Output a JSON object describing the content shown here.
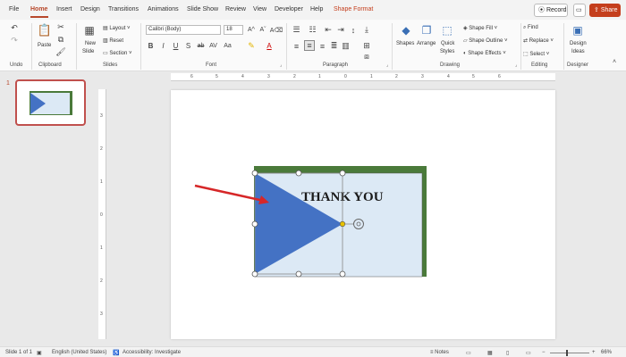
{
  "tabs": [
    {
      "label": "File"
    },
    {
      "label": "Home"
    },
    {
      "label": "Insert"
    },
    {
      "label": "Design"
    },
    {
      "label": "Transitions"
    },
    {
      "label": "Animations"
    },
    {
      "label": "Slide Show"
    },
    {
      "label": "Review"
    },
    {
      "label": "View"
    },
    {
      "label": "Developer"
    },
    {
      "label": "Help"
    },
    {
      "label": "Shape Format"
    }
  ],
  "top_buttons": {
    "record": "Record",
    "share": "Share"
  },
  "ribbon": {
    "undo_group": "Undo",
    "clipboard": {
      "paste": "Paste",
      "group": "Clipboard"
    },
    "slides": {
      "new_slide_line1": "New",
      "new_slide_line2": "Slide",
      "layout": "Layout",
      "reset": "Reset",
      "section": "Section",
      "group": "Slides"
    },
    "font": {
      "name": "Calibri (Body)",
      "size": "18",
      "group": "Font"
    },
    "paragraph": {
      "group": "Paragraph"
    },
    "drawing": {
      "shapes": "Shapes",
      "arrange": "Arrange",
      "quick_styles_line1": "Quick",
      "quick_styles_line2": "Styles",
      "shape_fill": "Shape Fill",
      "shape_outline": "Shape Outline",
      "shape_effects": "Shape Effects",
      "group": "Drawing"
    },
    "editing": {
      "find": "Find",
      "replace": "Replace",
      "select": "Select",
      "group": "Editing"
    },
    "designer": {
      "design_ideas_line1": "Design",
      "design_ideas_line2": "Ideas",
      "group": "Designer"
    }
  },
  "thumbnail": {
    "number": "1"
  },
  "ruler": {
    "h_ticks": [
      "6",
      "5",
      "4",
      "3",
      "2",
      "1",
      "0",
      "1",
      "2",
      "3",
      "4",
      "5",
      "6"
    ],
    "v_ticks": [
      "3",
      "2",
      "1",
      "0",
      "1",
      "2",
      "3"
    ]
  },
  "slide": {
    "title_text": "THANK YOU"
  },
  "colors": {
    "accent": "#b7472a",
    "frame_green": "#4a7a3a",
    "card_fill": "#dce9f5",
    "triangle": "#4472c4",
    "arrow": "#d62728"
  },
  "status": {
    "slide_count": "Slide 1 of 1",
    "language": "English (United States)",
    "accessibility": "Accessibility: Investigate",
    "notes": "Notes",
    "zoom": "66%"
  }
}
